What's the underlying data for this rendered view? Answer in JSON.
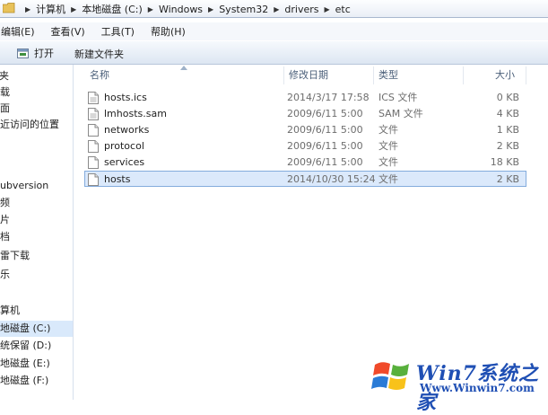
{
  "address": {
    "crumbs": [
      "计算机",
      "本地磁盘 (C:)",
      "Windows",
      "System32",
      "drivers",
      "etc"
    ]
  },
  "menu": [
    "编辑(E)",
    "查看(V)",
    "工具(T)",
    "帮助(H)"
  ],
  "toolbar": {
    "open_label": "打开",
    "new_folder_label": "新建文件夹"
  },
  "nav": {
    "items": [
      {
        "label": "读夹"
      },
      {
        "label": "下载"
      },
      {
        "label": "桌面"
      },
      {
        "label": "最近访问的位置"
      },
      {
        "label": "Subversion"
      },
      {
        "label": "视频"
      },
      {
        "label": "图片"
      },
      {
        "label": "文档"
      },
      {
        "label": "迅雷下载"
      },
      {
        "label": "音乐"
      },
      {
        "label": "计算机"
      },
      {
        "label": "本地磁盘 (C:)"
      },
      {
        "label": "系统保留 (D:)"
      },
      {
        "label": "本地磁盘 (E:)"
      },
      {
        "label": "本地磁盘 (F:)"
      }
    ]
  },
  "columns": {
    "name": "名称",
    "date": "修改日期",
    "type": "类型",
    "size": "大小"
  },
  "files": [
    {
      "name": "hosts.ics",
      "date": "2014/3/17 17:58",
      "type": "ICS 文件",
      "size": "0 KB"
    },
    {
      "name": "lmhosts.sam",
      "date": "2009/6/11 5:00",
      "type": "SAM 文件",
      "size": "4 KB"
    },
    {
      "name": "networks",
      "date": "2009/6/11 5:00",
      "type": "文件",
      "size": "1 KB"
    },
    {
      "name": "protocol",
      "date": "2009/6/11 5:00",
      "type": "文件",
      "size": "2 KB"
    },
    {
      "name": "services",
      "date": "2009/6/11 5:00",
      "type": "文件",
      "size": "18 KB"
    },
    {
      "name": "hosts",
      "date": "2014/10/30 15:24",
      "type": "文件",
      "size": "2 KB"
    }
  ],
  "watermark": {
    "title": "Win7系统之家",
    "url": "Www.Winwin7.com"
  },
  "colors": {
    "selection_bg": "#dbe9fb",
    "selection_border": "#84acdd",
    "header_text": "#4c607a",
    "watermark_blue": "#1f4fb4"
  }
}
